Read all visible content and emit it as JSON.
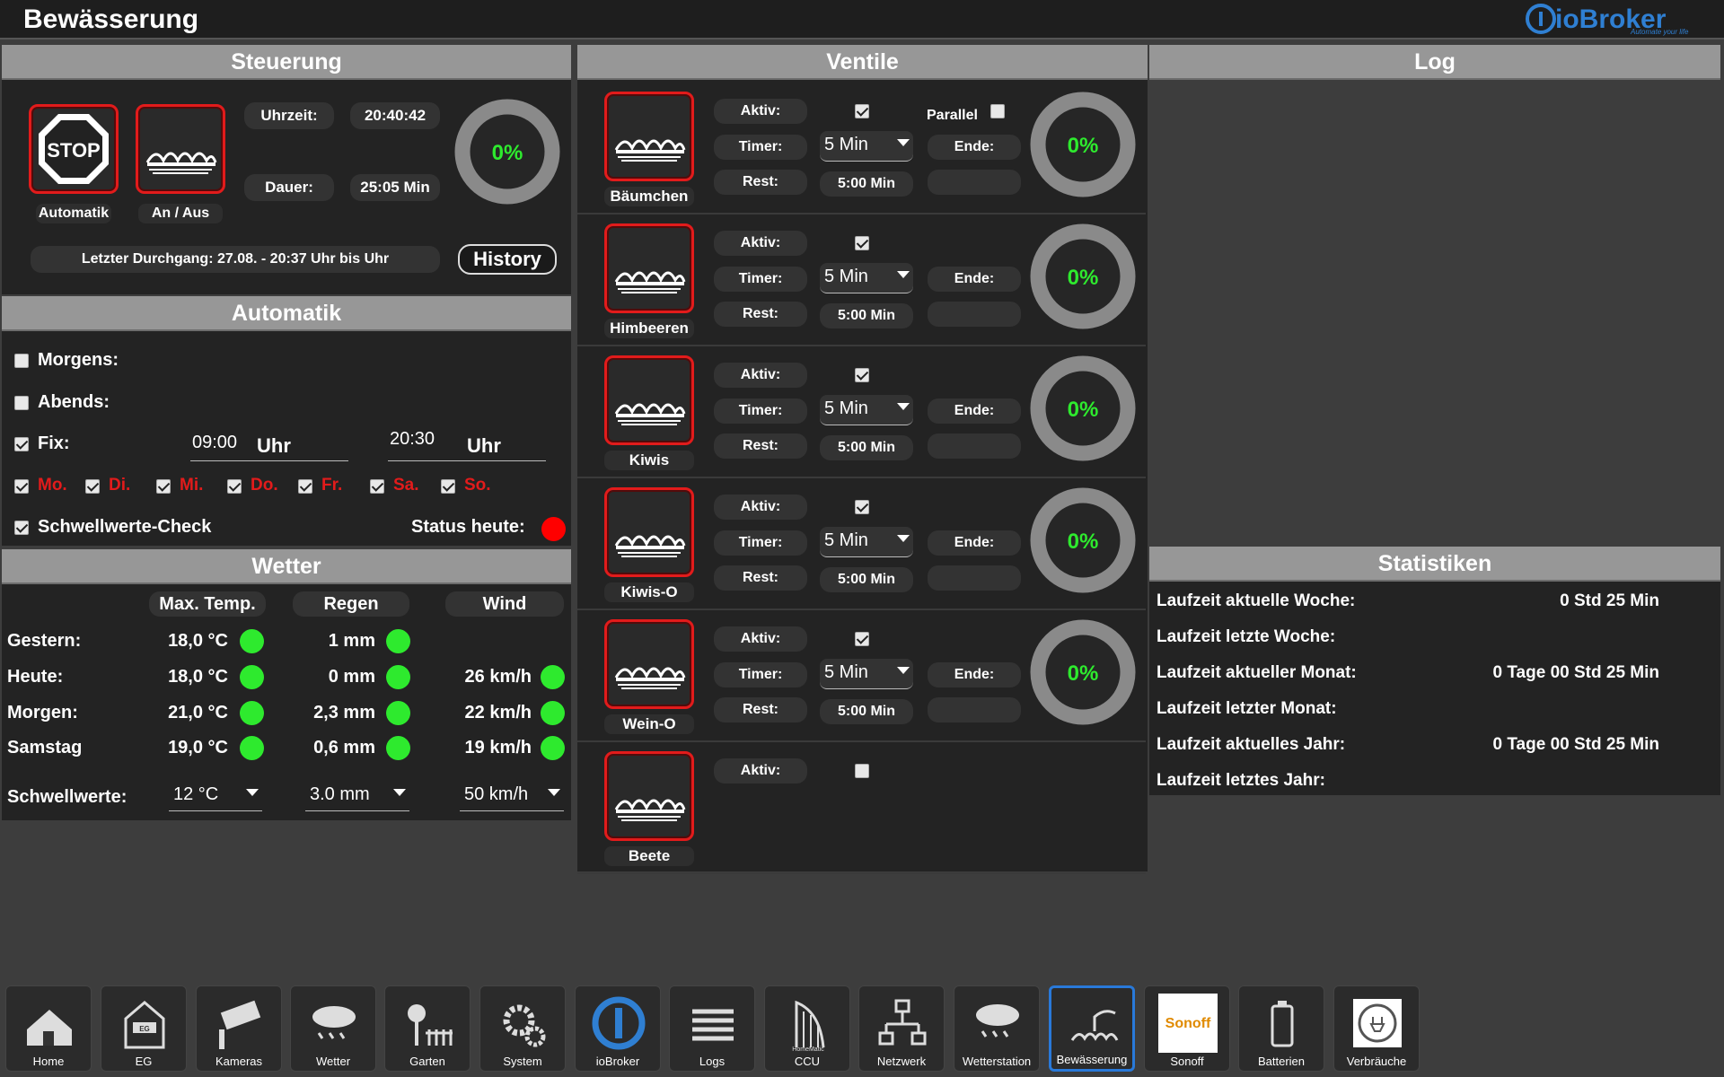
{
  "app": {
    "title": "Bewässerung",
    "logo": "ioBroker",
    "logo_tagline": "Automate your life"
  },
  "steuerung": {
    "heading": "Steuerung",
    "btn_automatik": "Automatik",
    "btn_anaus": "An / Aus",
    "stop_text": "STOP",
    "uhrzeit_label": "Uhrzeit:",
    "uhrzeit_value": "20:40:42",
    "dauer_label": "Dauer:",
    "dauer_value": "25:05 Min",
    "gauge": "0%",
    "gauge_fraction": 0,
    "letzter": "Letzter Durchgang: 27.08. - 20:37 Uhr bis Uhr",
    "history": "History"
  },
  "automatik": {
    "heading": "Automatik",
    "morgens": "Morgens:",
    "morgens_checked": false,
    "abends": "Abends:",
    "abends_checked": false,
    "fix": "Fix:",
    "fix_checked": true,
    "time1": "09:00",
    "time1_unit": "Uhr",
    "time2": "20:30",
    "time2_unit": "Uhr",
    "days": [
      "Mo.",
      "Di.",
      "Mi.",
      "Do.",
      "Fr.",
      "Sa.",
      "So."
    ],
    "schwellwerte_check": "Schwellwerte-Check",
    "status_heute": "Status heute:",
    "status_color": "#ff0000"
  },
  "wetter": {
    "heading": "Wetter",
    "col_temp": "Max. Temp.",
    "col_regen": "Regen",
    "col_wind": "Wind",
    "rows": [
      {
        "label": "Gestern:",
        "temp": "18,0 °C",
        "regen": "1 mm",
        "wind": ""
      },
      {
        "label": "Heute:",
        "temp": "18,0 °C",
        "regen": "0 mm",
        "wind": "26 km/h"
      },
      {
        "label": "Morgen:",
        "temp": "21,0 °C",
        "regen": "2,3 mm",
        "wind": "22 km/h"
      },
      {
        "label": "Samstag",
        "temp": "19,0 °C",
        "regen": "0,6 mm",
        "wind": "19 km/h"
      }
    ],
    "schwellwerte": "Schwellwerte:",
    "sw_temp": "12 °C",
    "sw_regen": "3.0 mm",
    "sw_wind": "50 km/h",
    "ok_color": "#2eea2e"
  },
  "ventile": {
    "heading": "Ventile",
    "aktiv": "Aktiv:",
    "timer": "Timer:",
    "rest": "Rest:",
    "ende": "Ende:",
    "parallel": "Parallel",
    "items": [
      {
        "name": "Bäumchen",
        "timer": "5 Min",
        "rest": "5:00 Min",
        "gauge": "0%",
        "active": true
      },
      {
        "name": "Himbeeren",
        "timer": "5 Min",
        "rest": "5:00 Min",
        "gauge": "0%",
        "active": true
      },
      {
        "name": "Kiwis",
        "timer": "5 Min",
        "rest": "5:00 Min",
        "gauge": "0%",
        "active": true
      },
      {
        "name": "Kiwis-O",
        "timer": "5 Min",
        "rest": "5:00 Min",
        "gauge": "0%",
        "active": true
      },
      {
        "name": "Wein-O",
        "timer": "5 Min",
        "rest": "5:00 Min",
        "gauge": "0%",
        "active": true
      },
      {
        "name": "Beete",
        "active": false
      }
    ]
  },
  "log": {
    "heading": "Log"
  },
  "statistiken": {
    "heading": "Statistiken",
    "rows": [
      {
        "label": "Laufzeit aktuelle Woche:",
        "value": "0 Std 25 Min"
      },
      {
        "label": "Laufzeit letzte Woche:",
        "value": ""
      },
      {
        "label": "Laufzeit aktueller Monat:",
        "value": "0 Tage 00 Std 25 Min"
      },
      {
        "label": "Laufzeit letzter Monat:",
        "value": ""
      },
      {
        "label": "Laufzeit aktuelles Jahr:",
        "value": "0 Tage 00 Std 25 Min"
      },
      {
        "label": "Laufzeit letztes Jahr:",
        "value": ""
      }
    ]
  },
  "nav": {
    "items": [
      {
        "label": "Home",
        "icon": "house-icon"
      },
      {
        "label": "EG",
        "icon": "floor-plan-icon",
        "icon_text": "EG"
      },
      {
        "label": "Kameras",
        "icon": "camera-icon"
      },
      {
        "label": "Wetter",
        "icon": "weather-cloud-icon"
      },
      {
        "label": "Garten",
        "icon": "garden-icon"
      },
      {
        "label": "System",
        "icon": "gears-icon"
      },
      {
        "label": "ioBroker",
        "icon": "iobroker-icon"
      },
      {
        "label": "Logs",
        "icon": "list-icon"
      },
      {
        "label": "CCU",
        "icon": "homematic-icon",
        "icon_text": "HomeMatic"
      },
      {
        "label": "Netzwerk",
        "icon": "network-icon"
      },
      {
        "label": "Wetterstation",
        "icon": "weather-station-icon"
      },
      {
        "label": "Bewässerung",
        "icon": "sprinkler-icon",
        "active": true
      },
      {
        "label": "Sonoff",
        "icon": "sonoff-icon",
        "icon_text": "Sonoff"
      },
      {
        "label": "Batterien",
        "icon": "battery-icon"
      },
      {
        "label": "Verbräuche",
        "icon": "plug-icon"
      }
    ]
  }
}
